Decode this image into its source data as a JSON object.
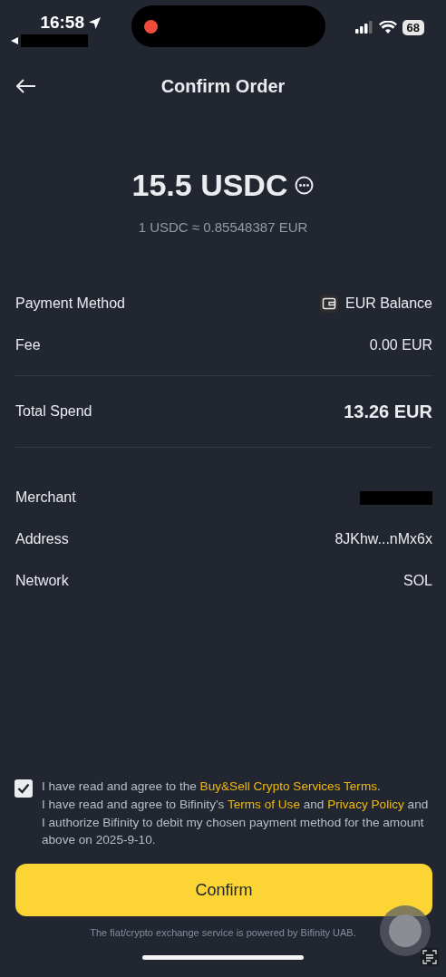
{
  "status_bar": {
    "time": "16:58",
    "battery": "68"
  },
  "header": {
    "title": "Confirm Order"
  },
  "amount": {
    "value": "15.5 USDC",
    "rate": "1 USDC ≈ 0.85548387 EUR"
  },
  "payment_rows": [
    {
      "label": "Payment Method",
      "value": "EUR Balance",
      "kind": "wallet"
    },
    {
      "label": "Fee",
      "value": "0.00 EUR",
      "kind": "plain"
    }
  ],
  "total": {
    "label": "Total Spend",
    "value": "13.26 EUR"
  },
  "detail_rows": [
    {
      "label": "Merchant",
      "kind": "redacted"
    },
    {
      "label": "Address",
      "value": "8JKhw...nMx6x",
      "kind": "plain"
    },
    {
      "label": "Network",
      "value": "SOL",
      "kind": "plain"
    }
  ],
  "agreement": {
    "checked": true,
    "parts": [
      {
        "kind": "text",
        "text": "I have read and agree to the "
      },
      {
        "kind": "link",
        "text": "Buy&Sell Crypto Services Terms"
      },
      {
        "kind": "text",
        "text": ".\nI have read and agree to Bifinity's "
      },
      {
        "kind": "link",
        "text": "Terms of Use"
      },
      {
        "kind": "text",
        "text": " and "
      },
      {
        "kind": "link",
        "text": "Privacy Policy"
      },
      {
        "kind": "text",
        "text": " and I authorize Bifinity to debit my chosen payment method for the amount above on 2025-9-10."
      }
    ]
  },
  "confirm_button": "Confirm",
  "footer": "The fiat/crypto exchange service is powered by Bifinity UAB."
}
